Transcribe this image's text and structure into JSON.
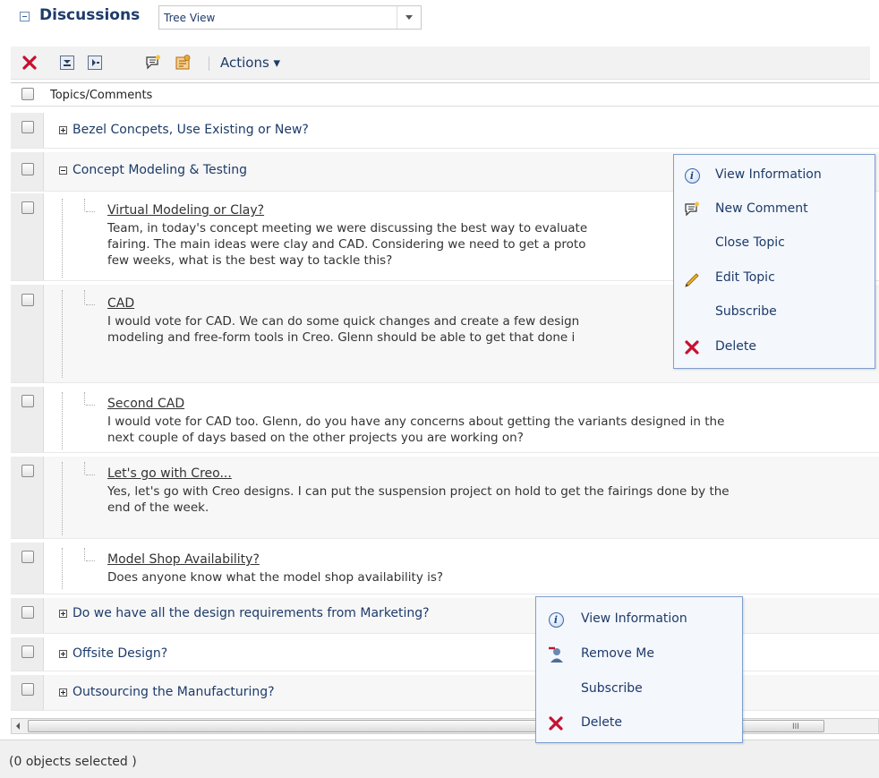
{
  "header": {
    "title": "Discussions",
    "view_select": {
      "value": "Tree View"
    }
  },
  "toolbar": {
    "actions_label": "Actions ▾",
    "icons": [
      "delete-icon",
      "expand-all-icon",
      "collapse-all-icon",
      "new-comment-icon",
      "new-topic-icon"
    ]
  },
  "table": {
    "column_header": "Topics/Comments",
    "topics": [
      {
        "title": "Bezel Concpets, Use Existing or New?",
        "expanded": false
      },
      {
        "title": "Concept Modeling & Testing",
        "expanded": true
      },
      {
        "title": "Do we have all the design requirements from Marketing?",
        "expanded": false
      },
      {
        "title": "Offsite Design?",
        "expanded": false
      },
      {
        "title": "Outsourcing the Manufacturing?",
        "expanded": false
      }
    ],
    "comments": [
      {
        "title": "Virtual Modeling or Clay?",
        "lines": [
          "Team, in today's concept meeting we were discussing the best way to evaluate",
          "fairing. The main ideas were clay and CAD. Considering we need to get a proto",
          "few weeks, what is the best way to tackle this?"
        ]
      },
      {
        "title": "CAD",
        "lines": [
          "I would vote for CAD. We can do some quick changes and create a few design",
          "modeling and free-form tools in Creo. Glenn should be able to get that done i"
        ]
      },
      {
        "title": "Second CAD",
        "lines": [
          "I would vote for CAD too. Glenn, do you have any concerns about getting the variants designed in the",
          "next couple of days based on the other projects you are working on?"
        ]
      },
      {
        "title": "Let's go with Creo...",
        "lines": [
          "Yes, let's go with Creo designs. I can put the suspension project on hold to get the fairings done by the",
          "end of the week."
        ]
      },
      {
        "title": "Model Shop Availability?",
        "lines": [
          "Does anyone know what the model shop availability is?"
        ]
      }
    ]
  },
  "topic_menu": {
    "items": [
      "View Information",
      "New Comment",
      "Close Topic",
      "Edit Topic",
      "Subscribe",
      "Delete"
    ]
  },
  "comment_menu": {
    "items": [
      "View Information",
      "Remove Me",
      "Subscribe",
      "Delete"
    ]
  },
  "scrollbar": {
    "grip": "III"
  },
  "status": {
    "text": "(0 objects selected )"
  },
  "colors": {
    "link": "#1d3b6a",
    "menu_border": "#7f9fcf",
    "delete_red": "#c8102e"
  }
}
